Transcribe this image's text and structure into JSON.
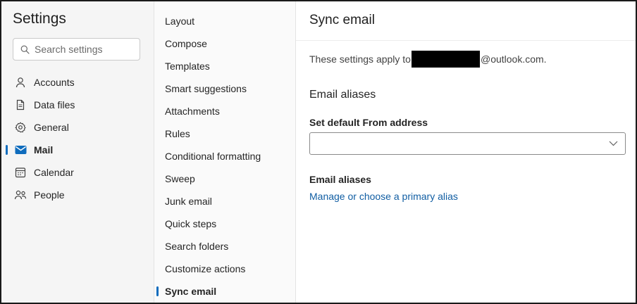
{
  "settings": {
    "title": "Settings"
  },
  "search": {
    "placeholder": "Search settings",
    "value": ""
  },
  "nav": {
    "items": [
      {
        "label": "Accounts",
        "icon": "person-icon",
        "active": false
      },
      {
        "label": "Data files",
        "icon": "document-icon",
        "active": false
      },
      {
        "label": "General",
        "icon": "gear-icon",
        "active": false
      },
      {
        "label": "Mail",
        "icon": "mail-icon",
        "active": true
      },
      {
        "label": "Calendar",
        "icon": "calendar-icon",
        "active": false
      },
      {
        "label": "People",
        "icon": "people-icon",
        "active": false
      }
    ]
  },
  "mail_nav": {
    "items": [
      {
        "label": "Layout"
      },
      {
        "label": "Compose"
      },
      {
        "label": "Templates"
      },
      {
        "label": "Smart suggestions"
      },
      {
        "label": "Attachments"
      },
      {
        "label": "Rules"
      },
      {
        "label": "Conditional formatting"
      },
      {
        "label": "Sweep"
      },
      {
        "label": "Junk email"
      },
      {
        "label": "Quick steps"
      },
      {
        "label": "Search folders"
      },
      {
        "label": "Customize actions"
      },
      {
        "label": "Sync email",
        "active": true
      }
    ]
  },
  "page": {
    "title": "Sync email",
    "apply_prefix": "These settings apply to",
    "apply_suffix": "@outlook.com.",
    "section_heading": "Email aliases",
    "default_from_label": "Set default From address",
    "default_from_value": "",
    "aliases_label": "Email aliases",
    "aliases_link": "Manage or choose a primary alias"
  },
  "colors": {
    "accent": "#0f6cbd",
    "link": "#115ea3",
    "sidebar_bg": "#f5f5f5",
    "subnav_bg": "#fafafa"
  }
}
